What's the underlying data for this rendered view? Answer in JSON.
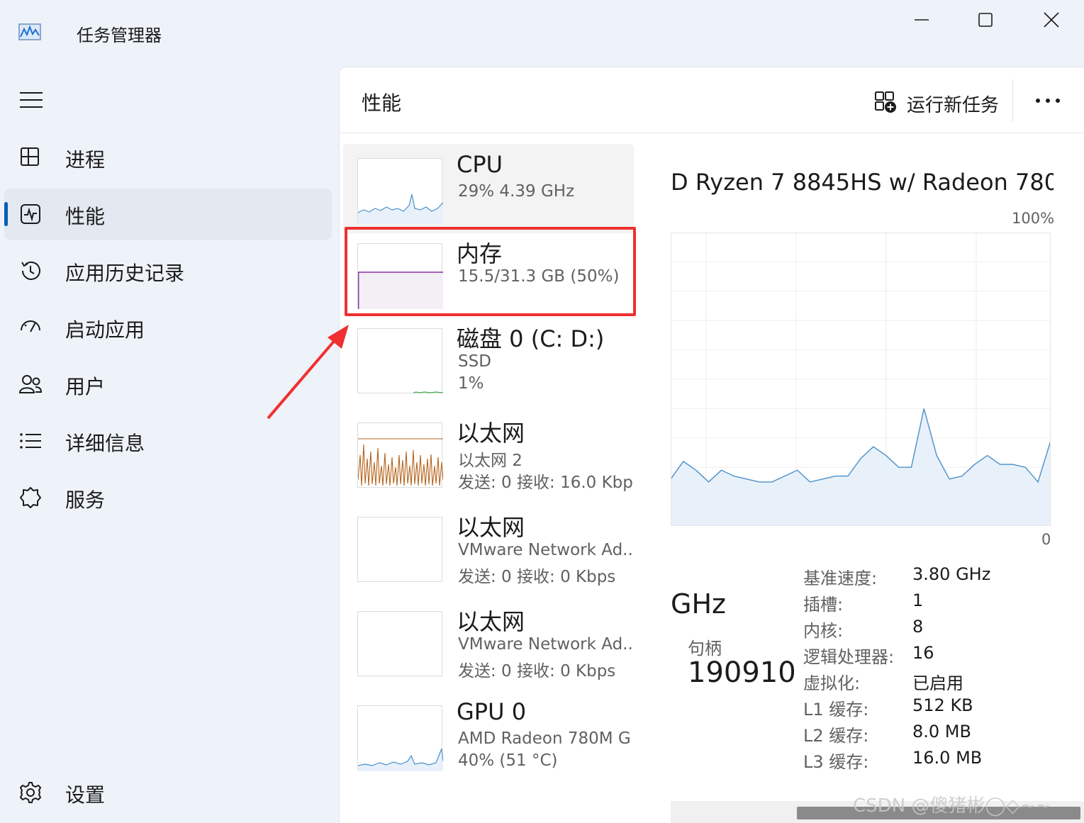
{
  "window": {
    "title": "任务管理器",
    "controls": [
      "minimize-icon",
      "maximize-icon",
      "close-icon"
    ]
  },
  "sidebar": {
    "items": [
      {
        "label": "进程",
        "icon": "processes-icon"
      },
      {
        "label": "性能",
        "icon": "performance-icon",
        "active": true
      },
      {
        "label": "应用历史记录",
        "icon": "history-icon"
      },
      {
        "label": "启动应用",
        "icon": "startup-icon"
      },
      {
        "label": "用户",
        "icon": "users-icon"
      },
      {
        "label": "详细信息",
        "icon": "details-icon"
      },
      {
        "label": "服务",
        "icon": "services-icon"
      }
    ],
    "settings": {
      "label": "设置",
      "icon": "gear-icon"
    }
  },
  "header": {
    "title": "性能",
    "run_task": "运行新任务",
    "more": "•••"
  },
  "devices": [
    {
      "title": "CPU",
      "lines": [
        "29%  4.39 GHz"
      ],
      "selected": true
    },
    {
      "title": "内存",
      "lines": [
        "15.5/31.3 GB (50%)"
      ]
    },
    {
      "title": "磁盘 0 (C: D:)",
      "lines": [
        "SSD",
        "1%"
      ]
    },
    {
      "title": "以太网",
      "lines": [
        "以太网 2",
        "发送: 0 接收: 16.0 Kbps"
      ]
    },
    {
      "title": "以太网",
      "lines": [
        "VMware Network Ad..",
        "发送: 0 接收: 0 Kbps"
      ]
    },
    {
      "title": "以太网",
      "lines": [
        "VMware Network Ad..",
        "发送: 0 接收: 0 Kbps"
      ]
    },
    {
      "title": "GPU 0",
      "lines": [
        "AMD Radeon 780M G",
        "40%  (51 °C)"
      ]
    }
  ],
  "detail": {
    "cpu_name": "D Ryzen 7 8845HS w/ Radeon 780...",
    "max_label": "100%",
    "min_label": "0",
    "speed_unit": "GHz",
    "handles_label": "句柄",
    "handles_value": "190910",
    "specs": [
      {
        "label": "基准速度:",
        "value": "3.80 GHz"
      },
      {
        "label": "插槽:",
        "value": "1"
      },
      {
        "label": "内核:",
        "value": "8"
      },
      {
        "label": "逻辑处理器:",
        "value": "16"
      },
      {
        "label": "虚拟化:",
        "value": "已启用"
      },
      {
        "label": "L1 缓存:",
        "value": "512 KB"
      },
      {
        "label": "L2 缓存:",
        "value": "8.0 MB"
      },
      {
        "label": "L3 缓存:",
        "value": "16.0 MB"
      }
    ]
  },
  "chart_data": {
    "type": "area",
    "ylim": [
      0,
      100
    ],
    "values": [
      16,
      22,
      19,
      15,
      19,
      17,
      16,
      15,
      15,
      17,
      19,
      15,
      16,
      17,
      17,
      23,
      27,
      24,
      20,
      20,
      40,
      24,
      16,
      17,
      21,
      24,
      21,
      21,
      20,
      15,
      29
    ],
    "grid": true,
    "colors": {
      "line": "#4a90c9",
      "fill": "#e8f1fa"
    }
  },
  "watermark": "CSDN @傻猪彬◯◇~~",
  "colors": {
    "accent": "#005fb8",
    "highlight": "#ef3030"
  }
}
